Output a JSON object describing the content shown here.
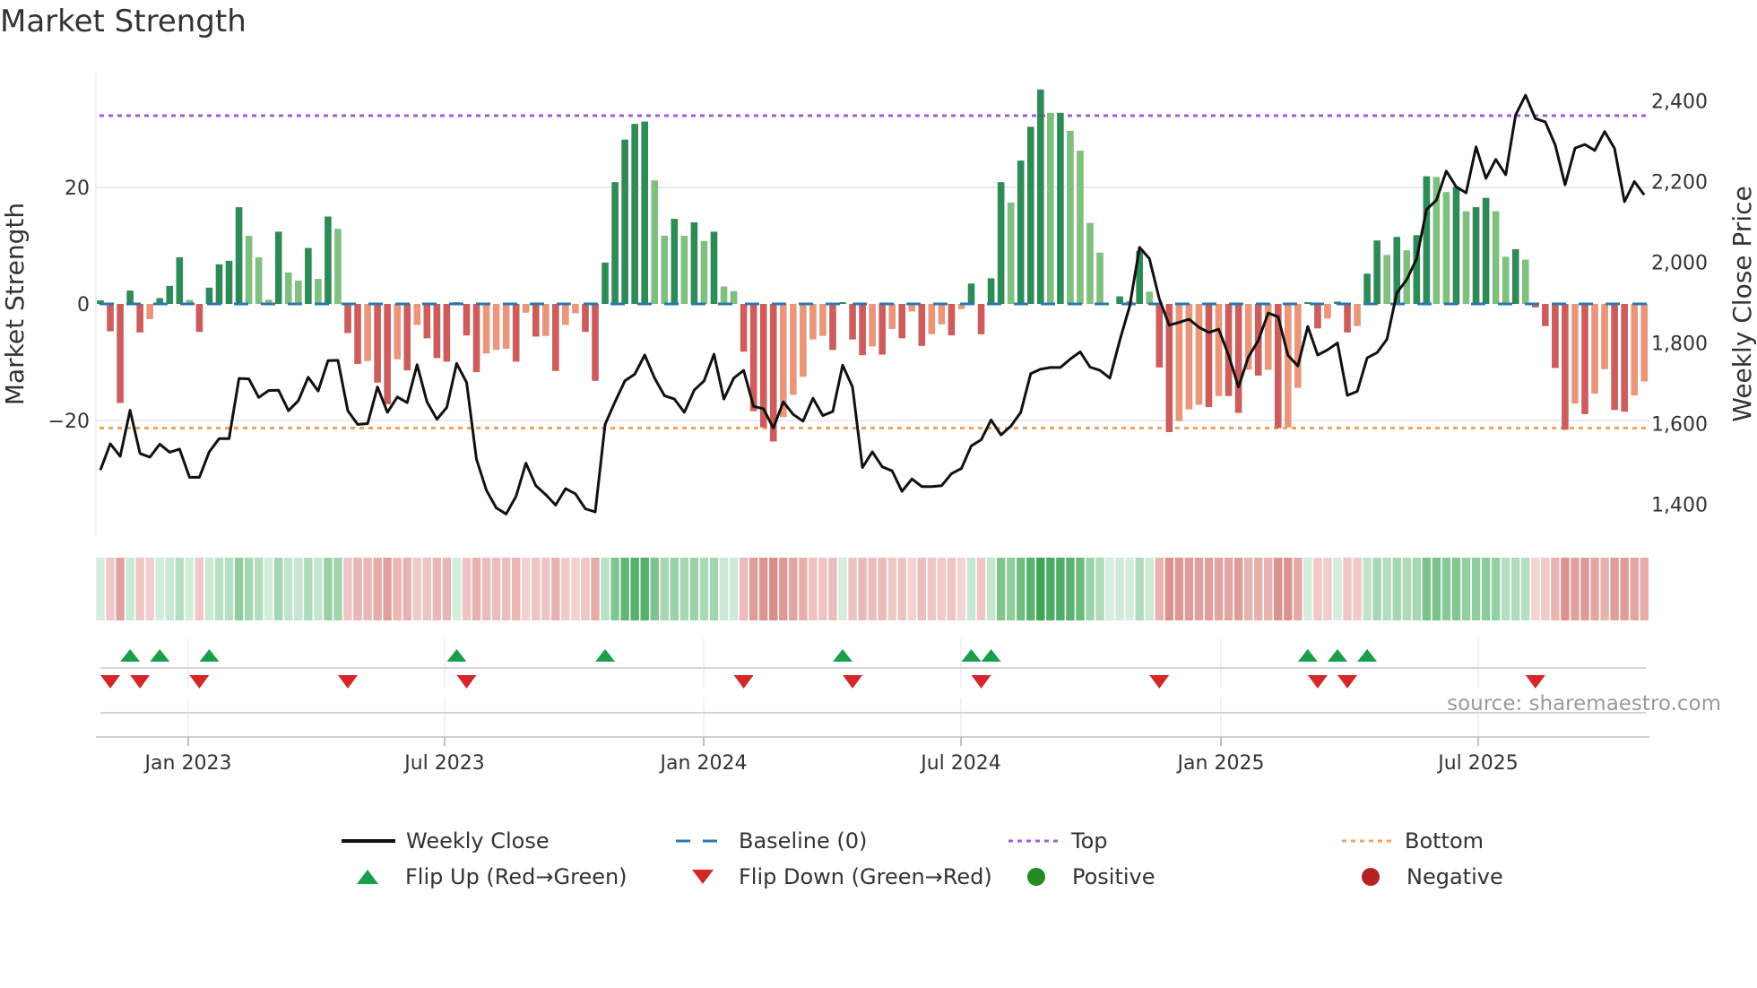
{
  "title": "Market Strength",
  "source": "source: sharemaestro.com",
  "colors": {
    "bar_green_dark": "#2e8b57",
    "bar_green_light": "#7fbf7f",
    "bar_red_dark": "#cd5c5c",
    "bar_red_light": "#e9967a",
    "close_line": "#111111",
    "baseline": "#2b78b0",
    "top": "#9b5de5",
    "bottom": "#f4a261",
    "flip_up": "#1a9e4a",
    "flip_down": "#d62728",
    "positive": "#228b22",
    "negative": "#b22222"
  },
  "legend": [
    {
      "key": "close",
      "label": "Weekly Close"
    },
    {
      "key": "baseline",
      "label": "Baseline (0)"
    },
    {
      "key": "top",
      "label": "Top"
    },
    {
      "key": "bottom",
      "label": "Bottom"
    },
    {
      "key": "flip_up",
      "label": "Flip Up (Red→Green)"
    },
    {
      "key": "flip_down",
      "label": "Flip Down (Green→Red)"
    },
    {
      "key": "positive",
      "label": "Positive"
    },
    {
      "key": "negative",
      "label": "Negative"
    }
  ],
  "chart_data": {
    "type": "bar",
    "title": "Market Strength",
    "xlabel": "",
    "ylabel": "Market Strength",
    "y2label": "Weekly Close Price",
    "x_unit": "week",
    "x_start_approx": "2022-11",
    "xticks": [
      "Jan 2023",
      "Jul 2023",
      "Jan 2024",
      "Jul 2024",
      "Jan 2025",
      "Jul 2025"
    ],
    "yticks": [
      {
        "v": 20,
        "label": "20"
      },
      {
        "v": 0,
        "label": "0"
      },
      {
        "v": -20,
        "label": "−20"
      }
    ],
    "y2ticks": [
      {
        "v": 2400,
        "label": "2,400"
      },
      {
        "v": 2200,
        "label": "2,200"
      },
      {
        "v": 2000,
        "label": "2,000"
      },
      {
        "v": 1800,
        "label": "1,800"
      },
      {
        "v": 1600,
        "label": "1,600"
      },
      {
        "v": 1400,
        "label": "1,400"
      }
    ],
    "ylim": [
      -32,
      40
    ],
    "y2lim": [
      1340,
      2450
    ],
    "reference_lines": {
      "baseline": 0,
      "top": 32.3,
      "bottom": -21.3
    },
    "series": [
      {
        "name": "Market Strength",
        "type": "bar",
        "axis": "left",
        "values": [
          0.6,
          -4.7,
          -17,
          2.3,
          -4.9,
          -2.6,
          1,
          3.1,
          8,
          0.7,
          -4.8,
          2.8,
          6.8,
          7.4,
          16.6,
          11.7,
          8,
          0.7,
          12.4,
          5.4,
          4,
          9.6,
          4.3,
          15,
          12.9,
          -5,
          -10.3,
          -9.8,
          -13.5,
          -17.2,
          -9.5,
          -11.4,
          -3.6,
          -5.9,
          -9.3,
          -9.9,
          0.3,
          -5.4,
          -11.7,
          -8.5,
          -7.9,
          -7.7,
          -9.9,
          -1.5,
          -5.6,
          -5.5,
          -11.5,
          -3.6,
          -1.6,
          -4.8,
          -13.2,
          7.1,
          20.9,
          28.2,
          30.9,
          31.3,
          21.2,
          11.7,
          14.6,
          11.7,
          14,
          10.8,
          12.4,
          3,
          2.2,
          -8.2,
          -18.4,
          -21.2,
          -23.6,
          -19.4,
          -15.6,
          -12.5,
          -6.1,
          -5.5,
          -7.9,
          0.3,
          -6.1,
          -8.8,
          -7.3,
          -8.7,
          -4.3,
          -5.9,
          -1.3,
          -7.2,
          -5.2,
          -3.5,
          -5.4,
          -0.9,
          3.5,
          -5.2,
          4.4,
          20.9,
          17.4,
          24.6,
          30.4,
          36.8,
          32.8,
          32.8,
          29.7,
          26.3,
          13.9,
          8.8,
          0,
          1.3,
          0.5,
          9.1,
          2.1,
          -10.9,
          -22,
          -20.1,
          -18.1,
          -17.3,
          -17.7,
          -15.8,
          -15.8,
          -18.7,
          -11.3,
          -12.3,
          -11.3,
          -21.3,
          -21.2,
          -14.4,
          0.3,
          -4.2,
          -2.5,
          0.4,
          -4.9,
          -3.8,
          5.2,
          10.9,
          8.4,
          11.5,
          9.2,
          11.8,
          21.9,
          21.8,
          19.2,
          20.1,
          15.9,
          16.6,
          18.2,
          15.9,
          8.1,
          9.4,
          7.6,
          -0.6,
          -3.8,
          -11,
          -21.6,
          -17.1,
          -18.9,
          -15.4,
          -11.2,
          -18.2,
          -18.5,
          -15.7,
          -13.3
        ]
      },
      {
        "name": "Weekly Close",
        "type": "line",
        "axis": "right",
        "values": [
          1485,
          1550,
          1519,
          1633,
          1526,
          1517,
          1549,
          1529,
          1537,
          1467,
          1467,
          1530,
          1563,
          1563,
          1712,
          1711,
          1665,
          1682,
          1683,
          1632,
          1657,
          1715,
          1681,
          1756,
          1757,
          1632,
          1598,
          1600,
          1691,
          1628,
          1666,
          1652,
          1746,
          1654,
          1611,
          1640,
          1749,
          1702,
          1512,
          1435,
          1391,
          1376,
          1420,
          1502,
          1446,
          1424,
          1398,
          1439,
          1426,
          1389,
          1381,
          1598,
          1654,
          1706,
          1723,
          1770,
          1713,
          1669,
          1661,
          1628,
          1683,
          1706,
          1772,
          1661,
          1713,
          1732,
          1643,
          1637,
          1589,
          1654,
          1623,
          1606,
          1663,
          1620,
          1630,
          1745,
          1691,
          1491,
          1530,
          1493,
          1483,
          1432,
          1463,
          1444,
          1444,
          1446,
          1476,
          1489,
          1545,
          1560,
          1609,
          1572,
          1594,
          1628,
          1724,
          1735,
          1739,
          1739,
          1760,
          1778,
          1740,
          1732,
          1713,
          1806,
          1891,
          2037,
          2009,
          1909,
          1844,
          1851,
          1859,
          1839,
          1826,
          1834,
          1769,
          1691,
          1765,
          1806,
          1874,
          1865,
          1769,
          1743,
          1841,
          1770,
          1783,
          1800,
          1670,
          1680,
          1763,
          1776,
          1809,
          1924,
          1957,
          2009,
          2131,
          2154,
          2226,
          2187,
          2172,
          2286,
          2208,
          2255,
          2217,
          2365,
          2414,
          2356,
          2348,
          2291,
          2192,
          2283,
          2292,
          2277,
          2324,
          2282,
          2150,
          2200,
          2167
        ]
      }
    ],
    "flip_up_weeks": [
      3,
      6,
      11,
      36,
      51,
      75,
      88,
      90,
      122,
      125,
      128
    ],
    "flip_down_weeks": [
      1,
      4,
      10,
      25,
      37,
      65,
      76,
      89,
      107,
      123,
      126,
      145
    ],
    "grid": true,
    "legend_position": "bottom"
  }
}
